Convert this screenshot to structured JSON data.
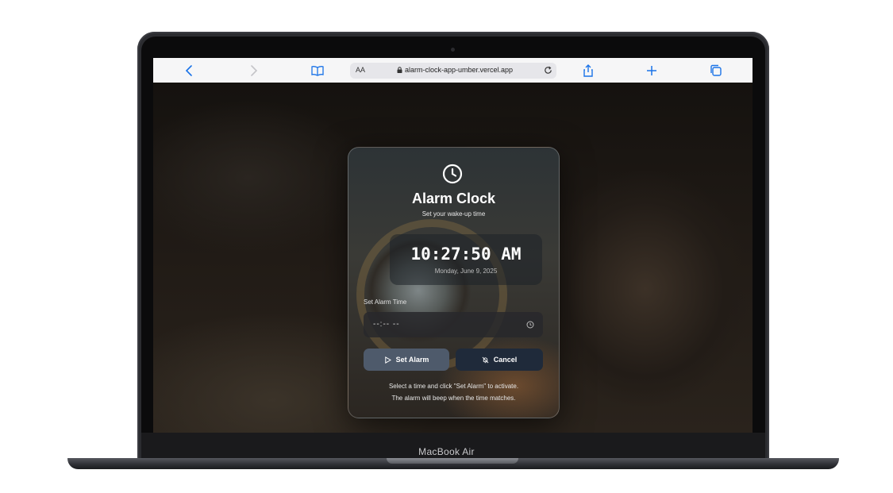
{
  "device": {
    "brand_label": "MacBook Air"
  },
  "browser": {
    "text_size_label": "AA",
    "url": "alarm-clock-app-umber.vercel.app",
    "icons": [
      "back-icon",
      "forward-icon",
      "bookmarks-icon",
      "lock-icon",
      "reload-icon",
      "share-icon",
      "new-tab-icon",
      "tabs-icon"
    ]
  },
  "app": {
    "title": "Alarm Clock",
    "subtitle": "Set your wake-up time",
    "current_time": "10:27:50 AM",
    "current_date": "Monday, June 9, 2025",
    "alarm_field_label": "Set Alarm Time",
    "alarm_input_value": "--:-- --",
    "set_button_label": "Set Alarm",
    "cancel_button_label": "Cancel",
    "hint_line_1": "Select a time and click \"Set Alarm\" to activate.",
    "hint_line_2": "The alarm will beep when the time matches.",
    "accent_colors": {
      "set_button": "#4e5a6b",
      "cancel_button": "#1f2a3a"
    }
  }
}
